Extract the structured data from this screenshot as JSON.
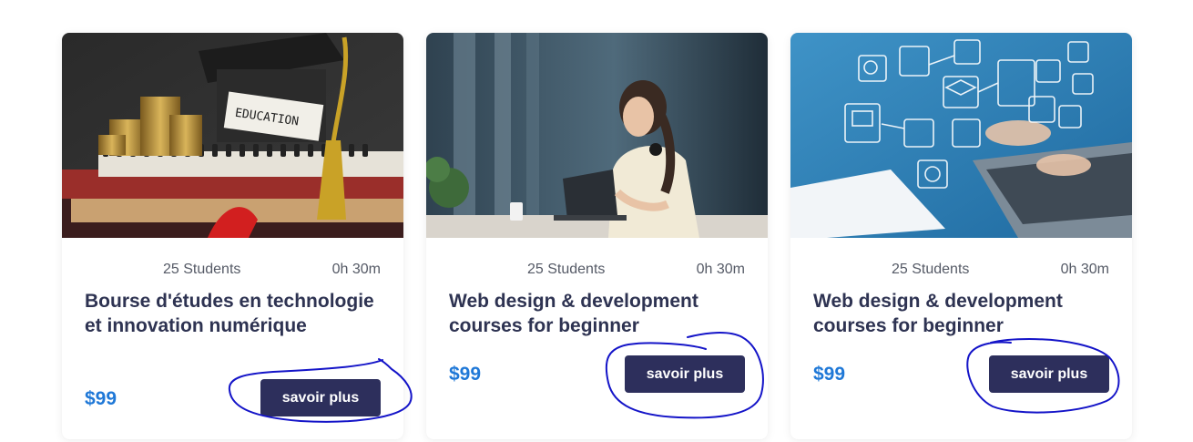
{
  "courses": [
    {
      "image": "education-graduation-cap-coins-books",
      "students": "25 Students",
      "duration": "0h 30m",
      "title": "Bourse d'études en technologie et innovation numérique",
      "price": "$99",
      "button_label": "savoir plus",
      "image_text": "EDUCATION"
    },
    {
      "image": "woman-laptop-headphones-office",
      "students": "25 Students",
      "duration": "0h 30m",
      "title": "Web design & development courses for beginner",
      "price": "$99",
      "button_label": "savoir plus"
    },
    {
      "image": "hands-laptop-digital-icons",
      "students": "25 Students",
      "duration": "0h 30m",
      "title": "Web design & development courses for beginner",
      "price": "$99",
      "button_label": "savoir plus"
    }
  ],
  "colors": {
    "title": "#2e3352",
    "price": "#1f78d7",
    "button": "#2d2f5c",
    "annotation": "#1414c8"
  }
}
